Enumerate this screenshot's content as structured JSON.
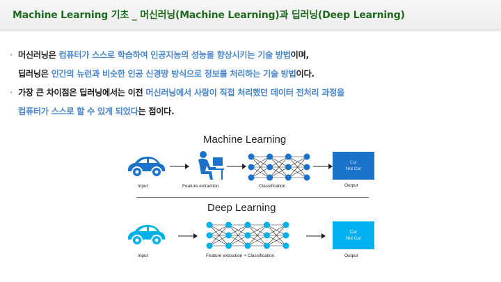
{
  "title": "Machine Learning 기초 _ 머신러닝(Machine Learning)과 딥러닝(Deep Learning)",
  "bullets": [
    {
      "marker": "·",
      "lines": [
        [
          {
            "text": "머신러닝은 ",
            "highlight": false
          },
          {
            "text": "컴퓨터가 스스로 학습하여 인공지능의 성능을 향상시키는 기술 방법",
            "highlight": true
          },
          {
            "text": "이며,",
            "highlight": false
          }
        ],
        [
          {
            "text": "딥러닝은 ",
            "highlight": false
          },
          {
            "text": "인간의 뉴런과 비슷한 인공 신경망 방식으로 정보를 처리하는 기술 방법",
            "highlight": true
          },
          {
            "text": "이다.",
            "highlight": false
          }
        ]
      ]
    },
    {
      "marker": "·",
      "lines": [
        [
          {
            "text": "가장 큰 차이점은 딥러닝에서는 이전 ",
            "highlight": false
          },
          {
            "text": "머신러닝에서 사람이 직접 처리했던 데이터 전처리 과정을",
            "highlight": true
          }
        ],
        [
          {
            "text": "컴퓨터가 스스로 할 수 있게 되었다",
            "highlight": true
          },
          {
            "text": "는 점이다.",
            "highlight": false
          }
        ]
      ]
    }
  ],
  "diagram": {
    "machine_learning": {
      "heading": "Machine Learning",
      "labels": {
        "input": "Input",
        "feature": "Feature extraction",
        "classification": "Classification",
        "output": "Output"
      },
      "output_box": {
        "line1": "Car",
        "line2": "Not Car"
      }
    },
    "deep_learning": {
      "heading": "Deep Learning",
      "labels": {
        "input": "Input",
        "feature_classification": "Feature extraction + Classification",
        "output": "Output"
      },
      "output_box": {
        "line1": "Car",
        "line2": "Not Car"
      }
    }
  },
  "colors": {
    "title": "#1e6b1e",
    "highlight": "#4a86c8",
    "ml_primary": "#1a73c9",
    "dl_primary": "#00b0e8",
    "ml_output_bg": "#1a73c9",
    "dl_output_bg": "#00b0f0"
  },
  "icons": [
    "car-icon",
    "person-at-computer-icon",
    "neural-network-icon",
    "arrow-icon"
  ]
}
